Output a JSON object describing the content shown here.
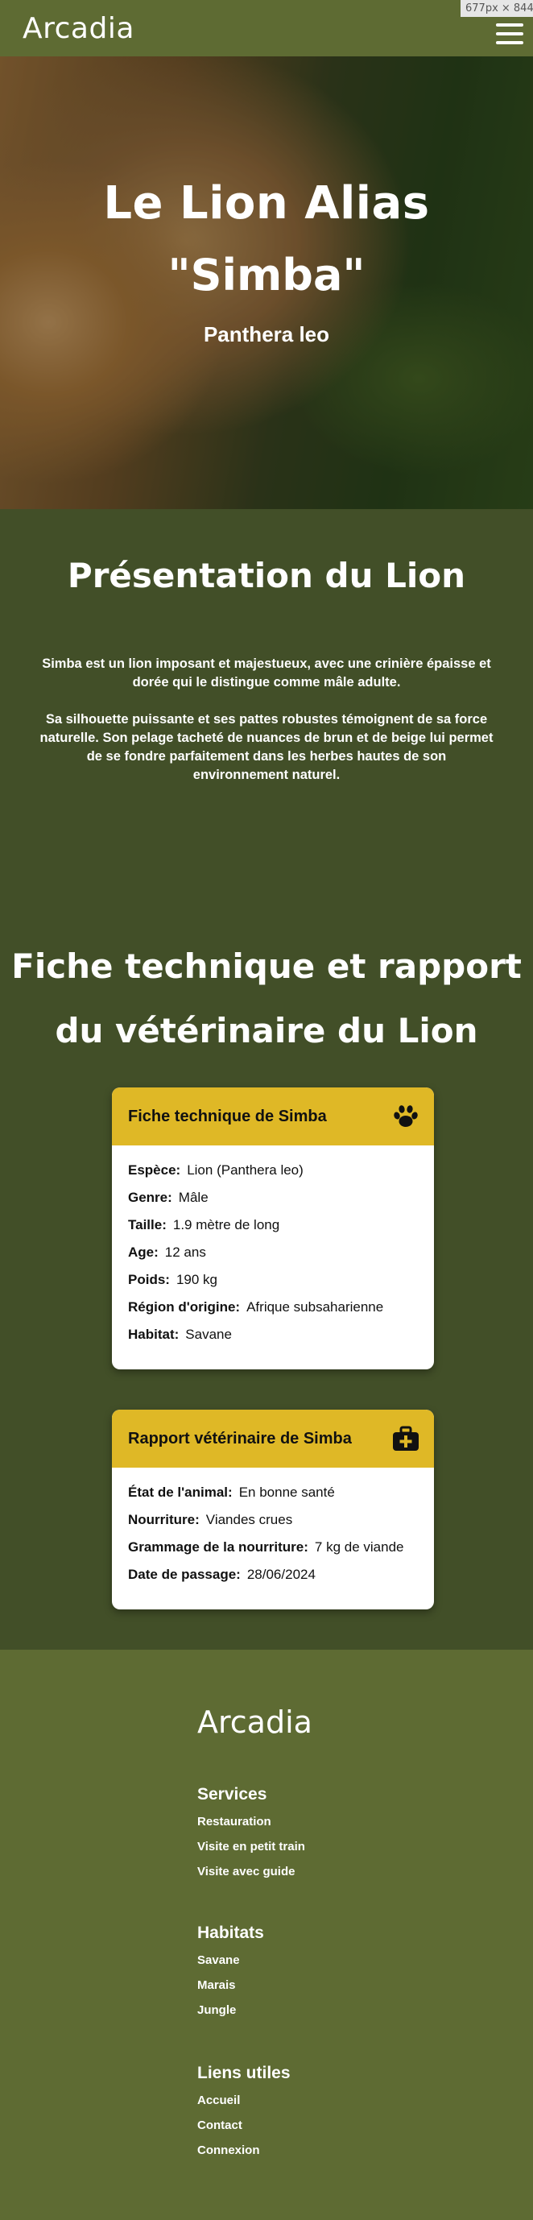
{
  "viewport_badge": "677px × 844px",
  "header": {
    "logo": "Arcadia",
    "menu_icon": "hamburger-icon"
  },
  "hero": {
    "title": "Le Lion Alias",
    "nickname": "\"Simba\"",
    "species": "Panthera leo"
  },
  "presentation": {
    "title": "Présentation du Lion",
    "p1": "Simba est un lion imposant et majestueux, avec une crinière épaisse et dorée qui le distingue comme mâle adulte.",
    "p2": "Sa silhouette puissante et ses pattes robustes témoignent de sa force naturelle. Son pelage tacheté de nuances de brun et de beige lui permet de se fondre parfaitement dans les herbes hautes de son environnement naturel."
  },
  "technical": {
    "title": "Fiche technique et rapport du vétérinaire du Lion"
  },
  "fiche": {
    "title": "Fiche technique de Simba",
    "icon": "paw-icon",
    "rows": [
      {
        "label": "Espèce:",
        "value": "Lion (Panthera leo)"
      },
      {
        "label": "Genre:",
        "value": "Mâle"
      },
      {
        "label": "Taille:",
        "value": "1.9 mètre de long"
      },
      {
        "label": "Age:",
        "value": "12 ans"
      },
      {
        "label": "Poids:",
        "value": "190 kg"
      },
      {
        "label": "Région d'origine:",
        "value": "Afrique subsaharienne"
      },
      {
        "label": "Habitat:",
        "value": "Savane"
      }
    ]
  },
  "rapport": {
    "title": "Rapport vétérinaire de Simba",
    "icon": "medical-kit-icon",
    "rows": [
      {
        "label": "État de l'animal:",
        "value": "En bonne santé"
      },
      {
        "label": "Nourriture:",
        "value": "Viandes crues"
      },
      {
        "label": "Grammage de la nourriture:",
        "value": "7 kg de viande"
      },
      {
        "label": "Date de passage:",
        "value": "28/06/2024"
      }
    ]
  },
  "footer": {
    "logo": "Arcadia",
    "groups": [
      {
        "title": "Services",
        "links": [
          "Restauration",
          "Visite en petit train",
          "Visite avec guide"
        ]
      },
      {
        "title": "Habitats",
        "links": [
          "Savane",
          "Marais",
          "Jungle"
        ]
      },
      {
        "title": "Liens utiles",
        "links": [
          "Accueil",
          "Contact",
          "Connexion"
        ]
      }
    ]
  },
  "colors": {
    "header_bg": "#5e6b33",
    "page_bg": "#424f28",
    "card_header": "#dfb826"
  }
}
